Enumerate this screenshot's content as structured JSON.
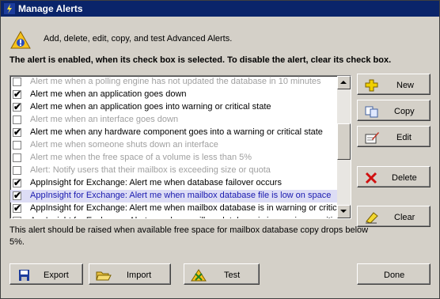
{
  "window": {
    "title": "Manage Alerts"
  },
  "header": {
    "description": "Add, delete, edit, copy, and test Advanced Alerts."
  },
  "instructions": "The alert is enabled, when its check box is selected. To disable the alert, clear its check box.",
  "alerts": [
    {
      "label": "Alert me when a polling engine has not updated the database in 10 minutes",
      "checked": false,
      "enabled": false,
      "selected": false
    },
    {
      "label": "Alert me when an application goes down",
      "checked": true,
      "enabled": true,
      "selected": false
    },
    {
      "label": "Alert me when an application goes into warning or critical state",
      "checked": true,
      "enabled": true,
      "selected": false
    },
    {
      "label": "Alert me when an interface goes down",
      "checked": false,
      "enabled": false,
      "selected": false
    },
    {
      "label": "Alert me when any hardware component goes into a warning or critical state",
      "checked": true,
      "enabled": true,
      "selected": false
    },
    {
      "label": "Alert me when someone shuts down an interface",
      "checked": false,
      "enabled": false,
      "selected": false
    },
    {
      "label": "Alert me when the free space of a volume is less than 5%",
      "checked": false,
      "enabled": false,
      "selected": false
    },
    {
      "label": "Alert: Notify users that their mailbox is exceeding size or quota",
      "checked": false,
      "enabled": false,
      "selected": false
    },
    {
      "label": "AppInsight for Exchange: Alert me when database failover occurs",
      "checked": true,
      "enabled": true,
      "selected": false
    },
    {
      "label": "AppInsight for Exchange: Alert me when mailbox database file is low on space",
      "checked": true,
      "enabled": true,
      "selected": true
    },
    {
      "label": "AppInsight for Exchange: Alert me when mailbox database is in warning or critical",
      "checked": true,
      "enabled": true,
      "selected": false
    },
    {
      "label": "AppInsight for Exchange: Alert me when mailbox database is in warning or critical",
      "checked": false,
      "enabled": true,
      "selected": false
    }
  ],
  "side_buttons": {
    "new": "New",
    "copy": "Copy",
    "edit": "Edit",
    "delete": "Delete",
    "clear": "Clear"
  },
  "selected_description": "This alert should be raised when available free space for mailbox database copy drops below 5%.",
  "bottom_buttons": {
    "export": "Export",
    "import": "Import",
    "test": "Test",
    "done": "Done"
  }
}
